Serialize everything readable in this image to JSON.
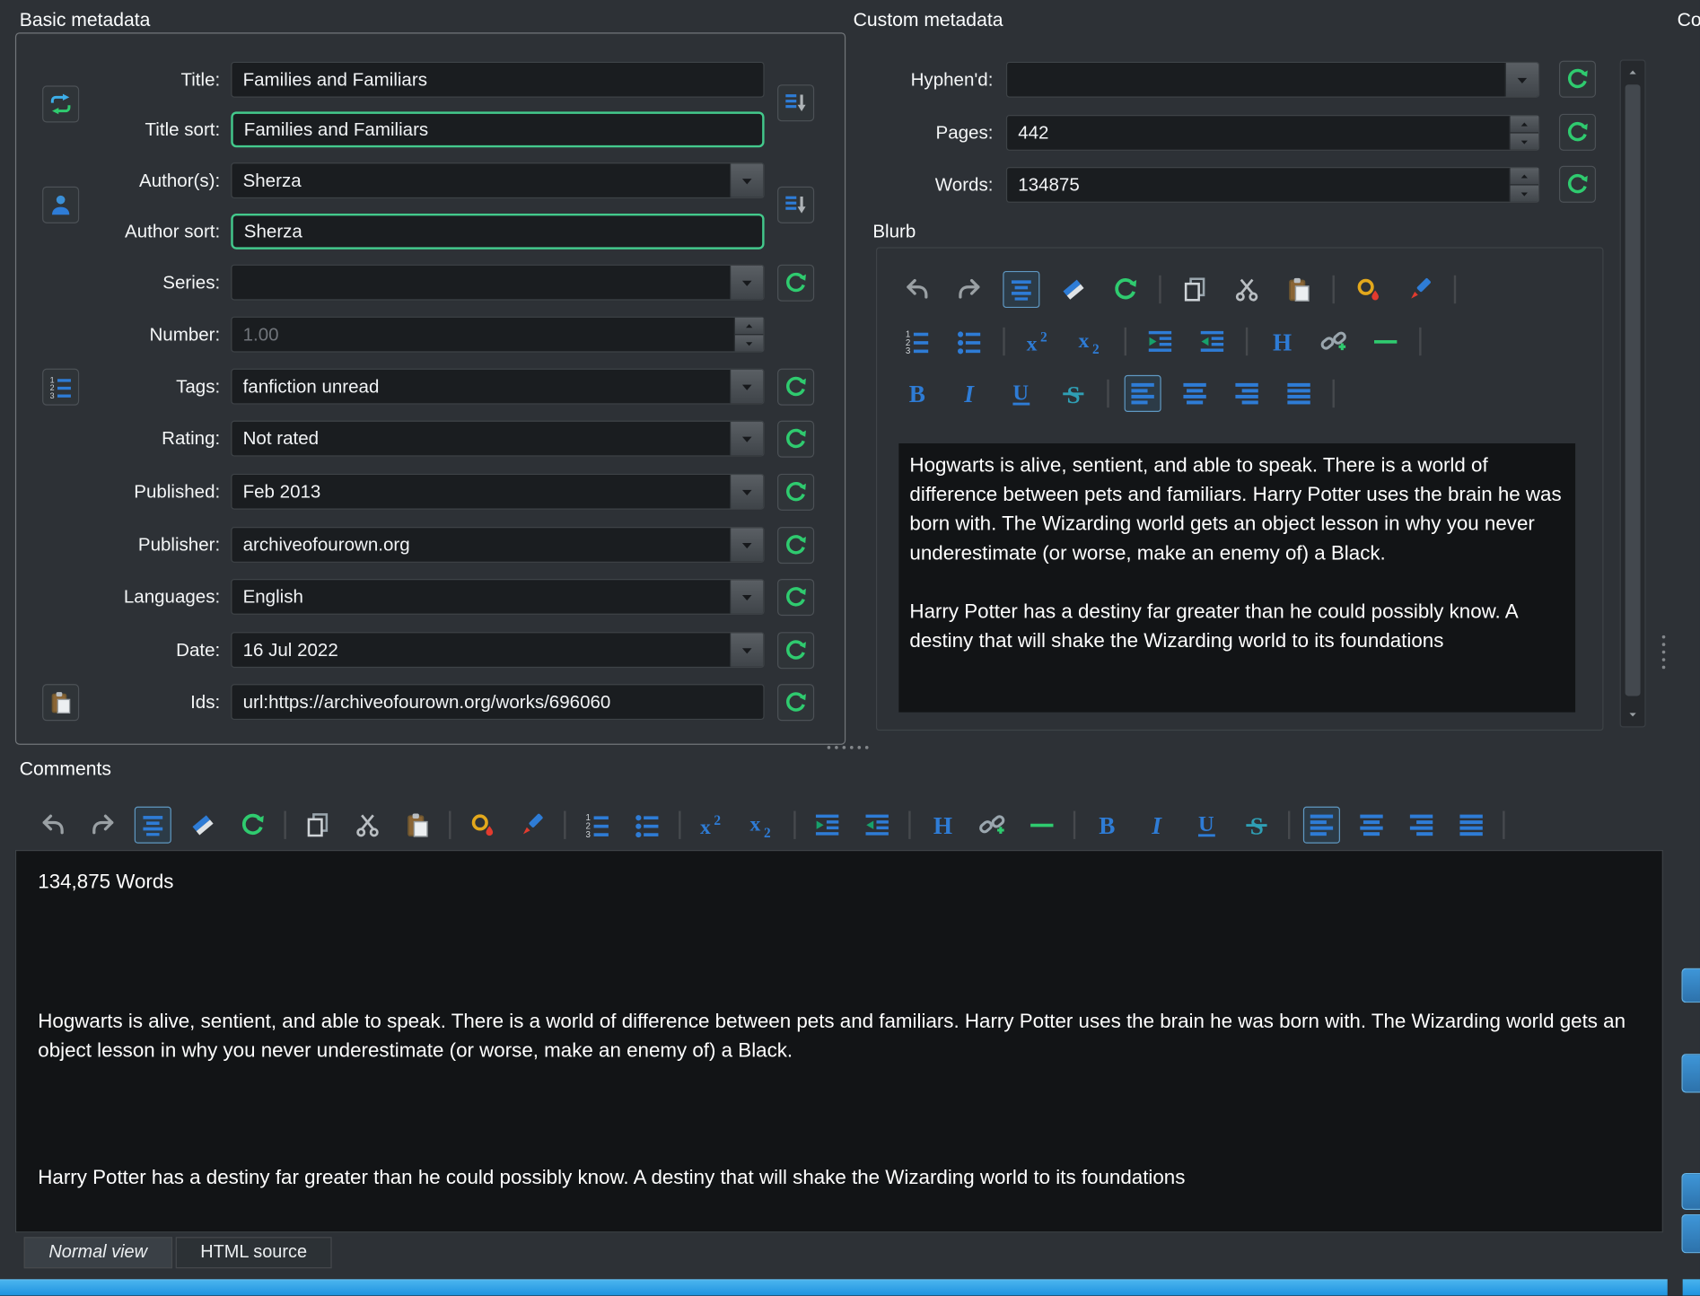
{
  "window": {
    "background": "#2d3136",
    "accent_blue": "#3daee9",
    "green": "#2fcb6f"
  },
  "basic": {
    "section_title": "Basic metadata",
    "title": {
      "label": "Title:",
      "value": "Families and Familiars"
    },
    "title_sort": {
      "label": "Title sort:",
      "value": "Families and Familiars"
    },
    "authors": {
      "label": "Author(s):",
      "value": "Sherza"
    },
    "author_sort": {
      "label": "Author sort:",
      "value": "Sherza"
    },
    "series": {
      "label": "Series:",
      "value": ""
    },
    "number": {
      "label": "Number:",
      "value": "1.00"
    },
    "tags": {
      "label": "Tags:",
      "value": "fanfiction unread"
    },
    "rating": {
      "label": "Rating:",
      "value": "Not rated"
    },
    "published": {
      "label": "Published:",
      "value": "Feb 2013"
    },
    "publisher": {
      "label": "Publisher:",
      "value": "archiveofourown.org"
    },
    "languages": {
      "label": "Languages:",
      "value": "English"
    },
    "date": {
      "label": "Date:",
      "value": "16 Jul 2022"
    },
    "ids": {
      "label": "Ids:",
      "value": "url:https://archiveofourown.org/works/696060"
    }
  },
  "custom": {
    "section_title": "Custom metadata",
    "hyphend": {
      "label": "Hyphen'd:",
      "value": ""
    },
    "pages": {
      "label": "Pages:",
      "value": "442"
    },
    "words": {
      "label": "Words:",
      "value": "134875"
    },
    "blurb_label": "Blurb"
  },
  "description": {
    "p1": "Hogwarts is alive, sentient, and able to speak. There is a world of difference between pets and familiars. Harry Potter uses the brain he was born with. The Wizarding world gets an object lesson in why you never underestimate (or worse, make an enemy of) a Black.",
    "p2": "Harry Potter has a destiny far greater than he could possibly know. A destiny that will shake the Wizarding world to its foundations"
  },
  "comments": {
    "section_title": "Comments",
    "word_count": "134,875 Words",
    "tabs": [
      {
        "label": "Normal view"
      },
      {
        "label": "HTML source"
      }
    ]
  },
  "right_panel": {
    "clipped_title": "Co"
  },
  "editor_toolbar": {
    "groups": [
      [
        "undo",
        "redo",
        "format-block",
        "eraser",
        "recycle"
      ],
      [
        "copy",
        "cut",
        "paste"
      ],
      [
        "fill-color",
        "text-color"
      ],
      [
        "ordered-list",
        "unordered-list"
      ],
      [
        "superscript",
        "subscript"
      ],
      [
        "indent-more",
        "indent-less"
      ],
      [
        "heading",
        "link",
        "horizontal-rule"
      ],
      [
        "bold",
        "italic",
        "underline",
        "strikethrough"
      ],
      [
        "align-left",
        "align-center",
        "align-right",
        "align-justify"
      ]
    ],
    "checked": [
      "format-block",
      "align-left"
    ]
  }
}
